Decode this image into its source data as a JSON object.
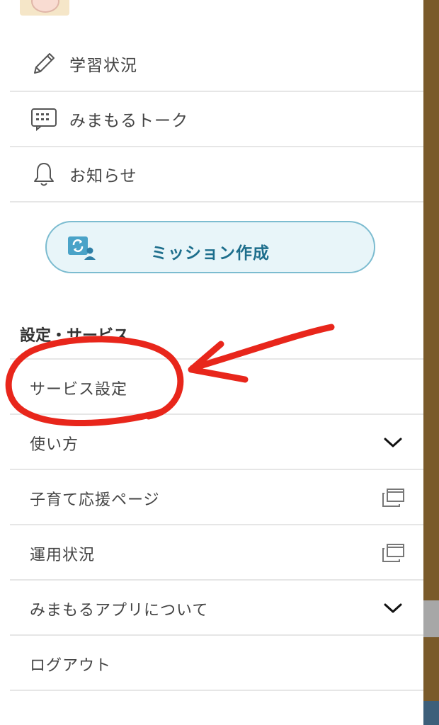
{
  "menu": {
    "items": [
      {
        "label": "学習状況",
        "icon": "pencil-icon"
      },
      {
        "label": "みまもるトーク",
        "icon": "chat-board-icon"
      },
      {
        "label": "お知らせ",
        "icon": "bell-icon"
      }
    ]
  },
  "mission_button": {
    "label": "ミッション作成",
    "icon": "mission-create-icon"
  },
  "settings": {
    "heading": "設定・サービス",
    "items": [
      {
        "label": "サービス設定",
        "indicator": "none"
      },
      {
        "label": "使い方",
        "indicator": "chevron-down-icon"
      },
      {
        "label": "子育て応援ページ",
        "indicator": "external-window-icon"
      },
      {
        "label": "運用状況",
        "indicator": "external-window-icon"
      },
      {
        "label": "みまもるアプリについて",
        "indicator": "chevron-down-icon"
      },
      {
        "label": "ログアウト",
        "indicator": "none"
      }
    ]
  },
  "colors": {
    "accent": "#1d6e8c",
    "button_bg": "#e8f5f9",
    "button_border": "#7cbcd0",
    "annotation_red": "#e8261b"
  }
}
